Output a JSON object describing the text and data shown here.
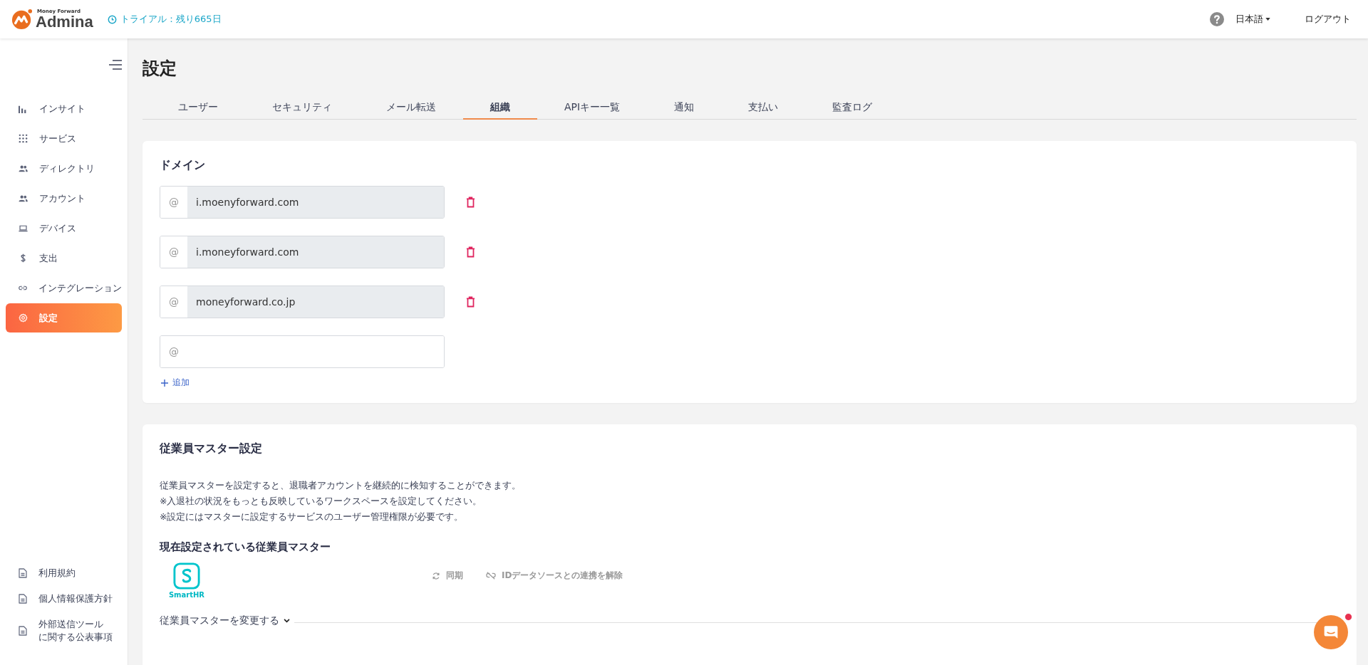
{
  "header": {
    "brand_small": "Money Forward",
    "brand": "Admina",
    "trial": "トライアル：残り665日",
    "language": "日本語",
    "logout": "ログアウト"
  },
  "sidebar": {
    "items": [
      {
        "label": "インサイト",
        "selected": false
      },
      {
        "label": "サービス",
        "selected": false
      },
      {
        "label": "ディレクトリ",
        "selected": false
      },
      {
        "label": "アカウント",
        "selected": false
      },
      {
        "label": "デバイス",
        "selected": false
      },
      {
        "label": "支出",
        "selected": false
      },
      {
        "label": "インテグレーション",
        "selected": false
      },
      {
        "label": "設定",
        "selected": true
      }
    ],
    "footer_links": [
      [
        "利用規約"
      ],
      [
        "個人情報保護方針"
      ],
      [
        "外部送信ツール",
        "に関する公表事項"
      ]
    ]
  },
  "page": {
    "title": "設定"
  },
  "tabs": [
    {
      "label": "ユーザー",
      "selected": false
    },
    {
      "label": "セキュリティ",
      "selected": false
    },
    {
      "label": "メール転送",
      "selected": false
    },
    {
      "label": "組織",
      "selected": true
    },
    {
      "label": "APIキー一覧",
      "selected": false
    },
    {
      "label": "通知",
      "selected": false
    },
    {
      "label": "支払い",
      "selected": false
    },
    {
      "label": "監査ログ",
      "selected": false
    }
  ],
  "domain_card": {
    "title": "ドメイン",
    "domains": [
      {
        "prefix": "@",
        "value": "i.moenyforward.com",
        "disabled": true
      },
      {
        "prefix": "@",
        "value": "i.moneyforward.com",
        "disabled": true
      },
      {
        "prefix": "@",
        "value": "moneyforward.co.jp",
        "disabled": true
      },
      {
        "prefix": "@",
        "disabled": false
      }
    ],
    "add": "追加"
  },
  "master_card": {
    "title": "従業員マスター設定",
    "description": [
      "従業員マスターを設定すると、退職者アカウントを継続的に検知することができます。",
      "※入退社の状況をもっとも反映しているワークスペースを設定してください。",
      "※設定にはマスターに設定するサービスのユーザー管理権限が必要です。"
    ],
    "current_title": "現在設定されている従業員マスター",
    "service_name": "SmartHR",
    "actions": [
      {
        "label": "同期",
        "disabled": true
      },
      {
        "label": "IDデータソースとの連携を解除",
        "disabled": true
      }
    ],
    "change": "従業員マスターを変更する"
  }
}
